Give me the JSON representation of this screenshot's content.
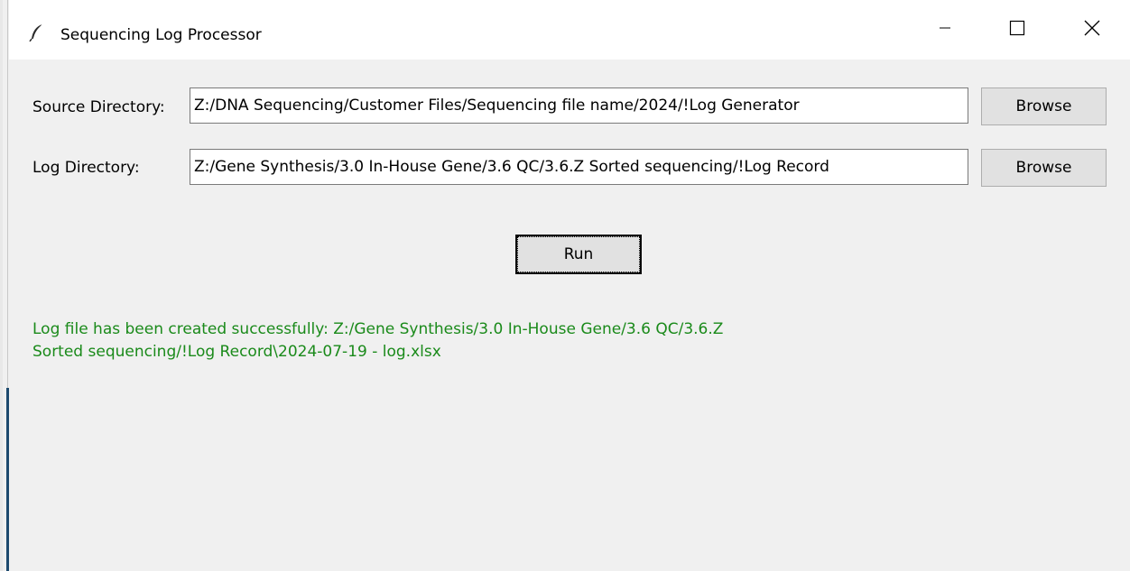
{
  "window": {
    "title": "Sequencing Log Processor",
    "icon": "feather-icon",
    "controls": [
      "minimize-icon",
      "maximize-icon",
      "close-icon"
    ]
  },
  "form": {
    "source": {
      "label": "Source Directory:",
      "value": "Z:/DNA Sequencing/Customer Files/Sequencing file name/2024/!Log Generator",
      "browse_label": "Browse"
    },
    "log": {
      "label": "Log Directory:",
      "value": "Z:/Gene Synthesis/3.0 In-House Gene/3.6 QC/3.6.Z Sorted sequencing/!Log Record",
      "browse_label": "Browse"
    },
    "run_label": "Run"
  },
  "status": {
    "line1": "Log file has been created successfully: Z:/Gene Synthesis/3.0 In-House Gene/3.6 QC/3.6.Z",
    "line2": "Sorted sequencing/!Log Record\\2024-07-19 - log.xlsx",
    "color": "#1a8a1a"
  }
}
